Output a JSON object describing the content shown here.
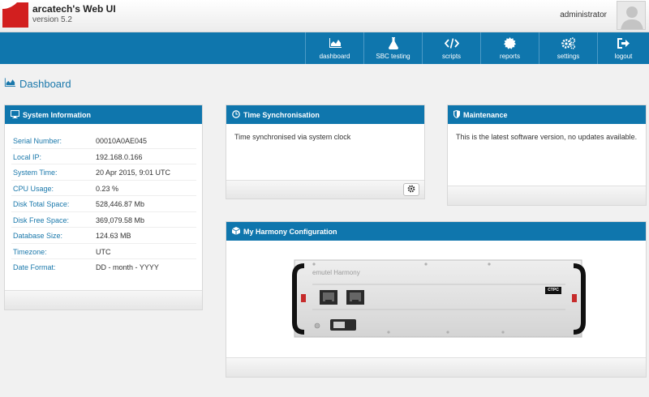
{
  "header": {
    "app_title": "arcatech's Web UI",
    "version": "version 5.2",
    "username": "administrator",
    "brand_color": "#d21f1f"
  },
  "nav": {
    "items": [
      {
        "label": "dashboard",
        "icon": "area-chart-icon"
      },
      {
        "label": "SBC testing",
        "icon": "flask-icon"
      },
      {
        "label": "scripts",
        "icon": "code-icon"
      },
      {
        "label": "reports",
        "icon": "certificate-icon"
      },
      {
        "label": "settings",
        "icon": "cogs-icon"
      },
      {
        "label": "logout",
        "icon": "sign-out-icon"
      }
    ],
    "color": "#0f76ad"
  },
  "page": {
    "title": "Dashboard"
  },
  "system_info": {
    "title": "System Information",
    "rows": [
      {
        "label": "Serial Number:",
        "value": "00010A0AE045"
      },
      {
        "label": "Local IP:",
        "value": "192.168.0.166"
      },
      {
        "label": "System Time:",
        "value": "20 Apr 2015, 9:01 UTC"
      },
      {
        "label": "CPU Usage:",
        "value": "0.23 %"
      },
      {
        "label": "Disk Total Space:",
        "value": "528,446.87 Mb"
      },
      {
        "label": "Disk Free Space:",
        "value": "369,079.58 Mb"
      },
      {
        "label": "Database Size:",
        "value": "124.63 MB"
      },
      {
        "label": "Timezone:",
        "value": "UTC"
      },
      {
        "label": "Date Format:",
        "value": "DD - month - YYYY"
      }
    ]
  },
  "time_sync": {
    "title": "Time Synchronisation",
    "message": "Time synchronised via system clock"
  },
  "maintenance": {
    "title": "Maintenance",
    "message": "This is the latest software version, no updates available."
  },
  "harmony": {
    "title": "My Harmony Configuration",
    "device_label": "emutel Harmony",
    "module_label": "CTPC"
  }
}
